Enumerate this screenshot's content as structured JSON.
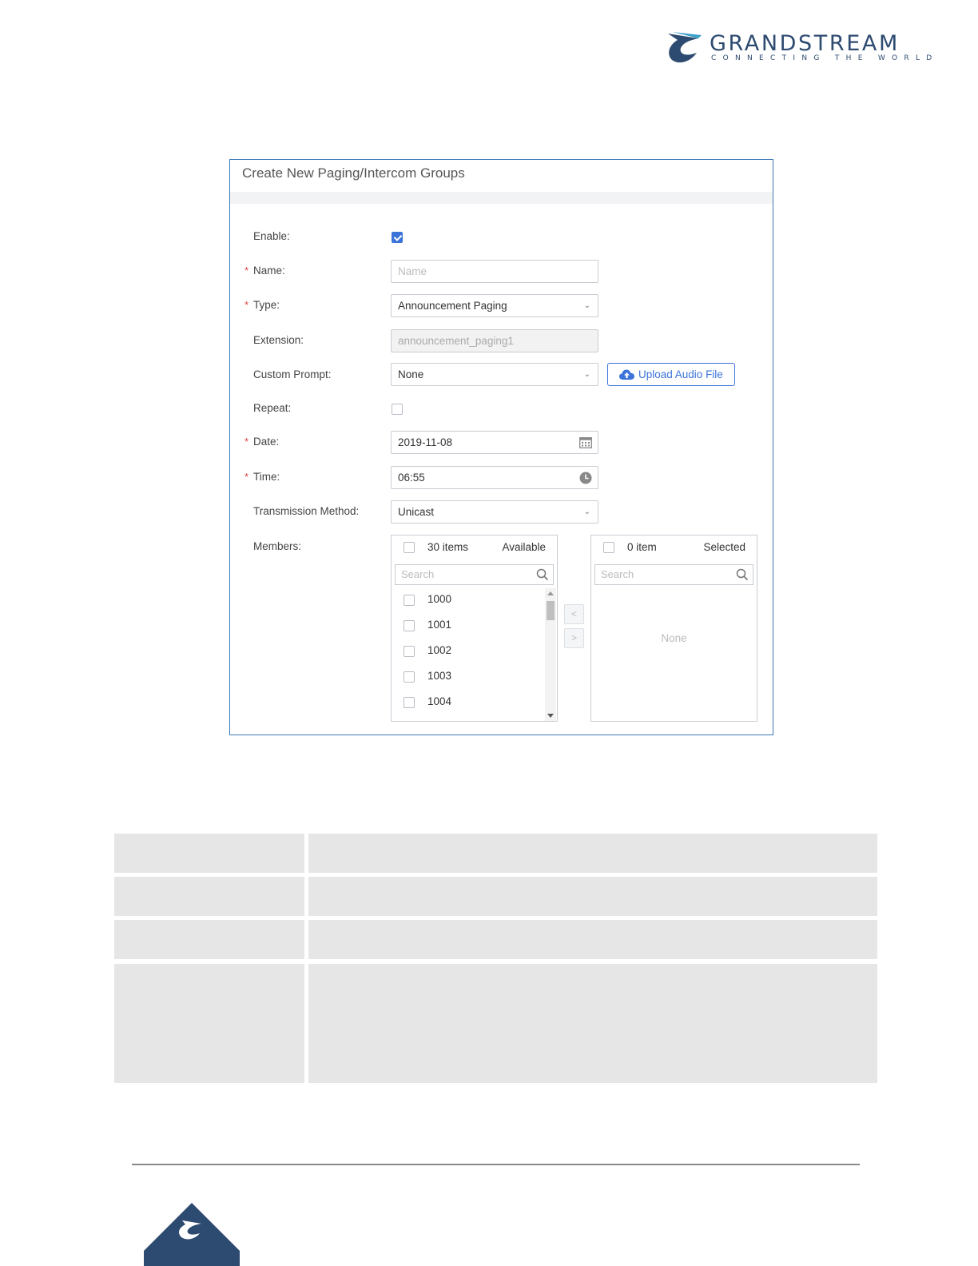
{
  "brand": {
    "name": "GRANDSTREAM",
    "tagline": "CONNECTING THE WORLD",
    "color": "#2d4a70"
  },
  "dialog": {
    "title": "Create New Paging/Intercom Groups",
    "required_mark": "*",
    "accent_color": "#3b73d9",
    "fields": {
      "enable": {
        "label": "Enable:",
        "checked": true
      },
      "name": {
        "label": "Name:",
        "placeholder": "Name",
        "value": ""
      },
      "type": {
        "label": "Type:",
        "value": "Announcement Paging"
      },
      "extension": {
        "label": "Extension:",
        "value": "announcement_paging1"
      },
      "custom_prompt": {
        "label": "Custom Prompt:",
        "value": "None",
        "upload_label": "Upload Audio File"
      },
      "repeat": {
        "label": "Repeat:",
        "checked": false
      },
      "date": {
        "label": "Date:",
        "value": "2019-11-08"
      },
      "time": {
        "label": "Time:",
        "value": "06:55"
      },
      "transmission_method": {
        "label": "Transmission Method:",
        "value": "Unicast"
      },
      "members": {
        "label": "Members:"
      }
    },
    "transfer": {
      "available": {
        "count": "30 items",
        "caption": "Available",
        "search_placeholder": "Search",
        "items": [
          "1000",
          "1001",
          "1002",
          "1003",
          "1004"
        ]
      },
      "selected": {
        "count": "0 item",
        "caption": "Selected",
        "search_placeholder": "Search",
        "empty_text": "None"
      },
      "move_left": "<",
      "move_right": ">"
    }
  },
  "icons": {
    "dropdown": "chevron-down-icon",
    "date": "calendar-icon",
    "time": "clock-icon",
    "upload": "cloud-upload-icon",
    "search": "search-icon"
  }
}
